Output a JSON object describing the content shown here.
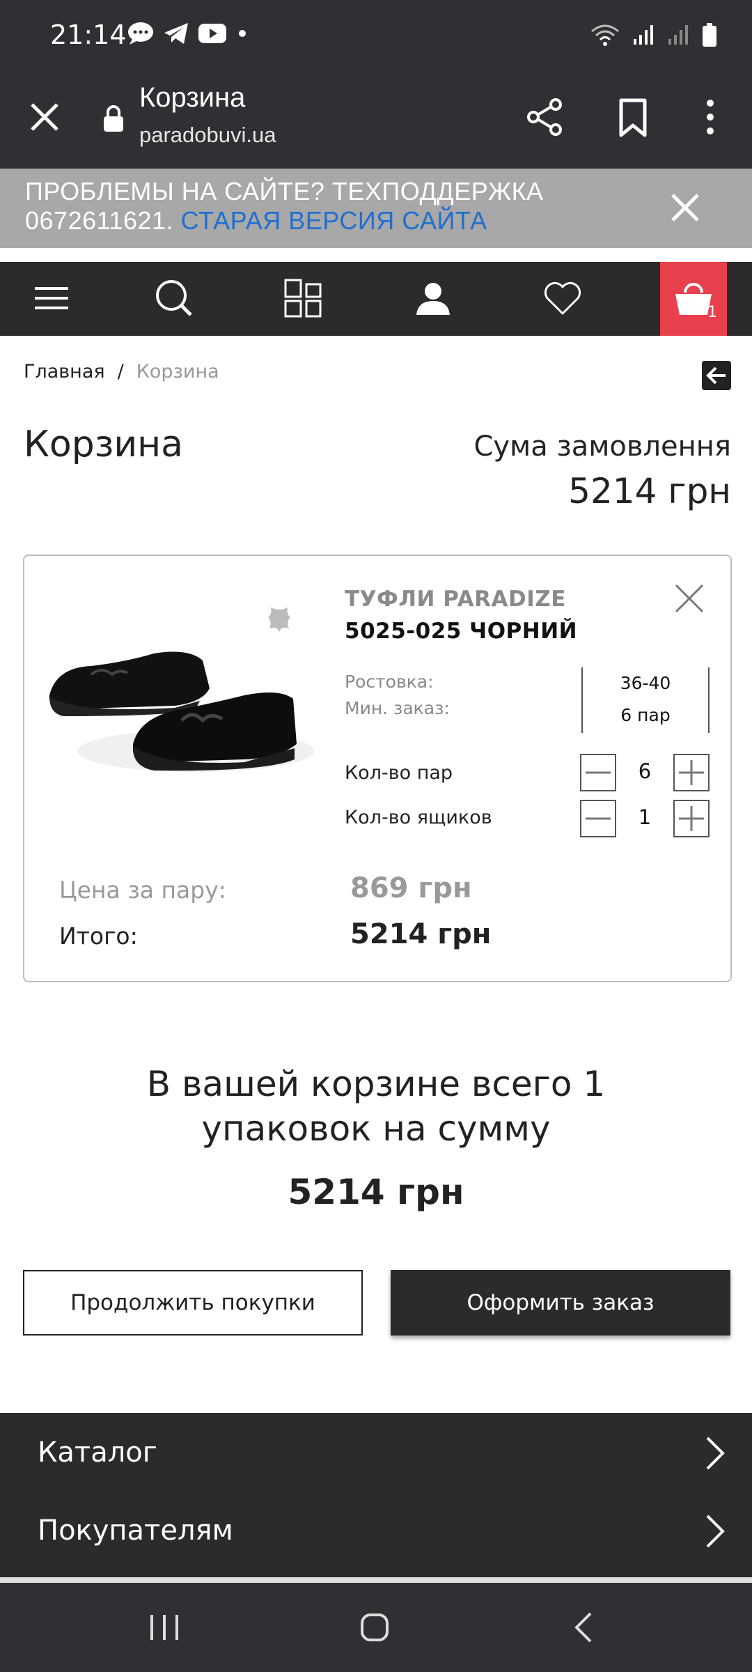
{
  "status_bar": {
    "time": "21:14"
  },
  "browser": {
    "title": "Корзина",
    "url": "paradobuvi.ua"
  },
  "banner": {
    "text": "ПРОБЛЕМЫ НА САЙТЕ? ТЕХПОДДЕРЖКА 0672611621. ",
    "link": "СТАРАЯ ВЕРСИЯ САЙТА"
  },
  "nav": {
    "cart_count": "1",
    "cart_color": "#e8404c"
  },
  "breadcrumb": {
    "home": "Главная",
    "separator": "/",
    "current": "Корзина"
  },
  "page": {
    "title": "Корзина",
    "sum_label": "Сума замовлення",
    "sum_value": "5214 грн"
  },
  "item": {
    "brand": "ТУФЛИ PARADIZE",
    "model": "5025-025 ЧОРНИЙ",
    "size_label": "Ростовка:",
    "min_order_label": "Мин. заказ:",
    "size_value": "36-40",
    "min_order_value": "6 пар",
    "pairs_label": "Кол-во пар",
    "pairs_value": "6",
    "boxes_label": "Кол-во ящиков",
    "boxes_value": "1",
    "price_label": "Цена за пару:",
    "price_value": "869 грн",
    "total_label": "Итого:",
    "total_value": "5214 грн"
  },
  "summary": {
    "line1": "В вашей корзине всего 1",
    "line2": "упаковок на сумму",
    "total": "5214 грн"
  },
  "buttons": {
    "continue": "Продолжить покупки",
    "checkout": "Оформить заказ"
  },
  "footer": {
    "items": [
      {
        "label": "Каталог"
      },
      {
        "label": "Покупателям"
      }
    ]
  }
}
